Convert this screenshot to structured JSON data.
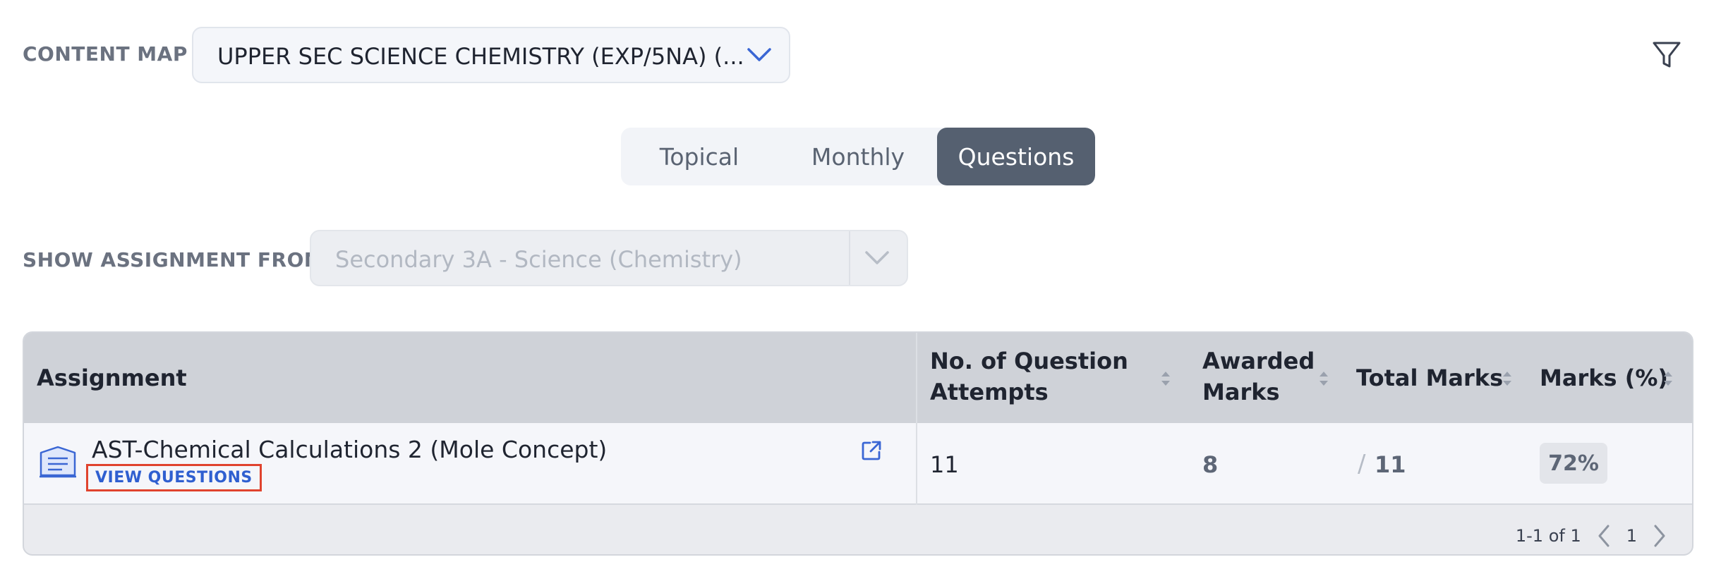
{
  "content_map": {
    "label": "CONTENT MAP",
    "selected": "UPPER SEC SCIENCE CHEMISTRY (EXP/5NA) (..."
  },
  "view_tabs": [
    {
      "label": "Topical",
      "active": false
    },
    {
      "label": "Monthly",
      "active": false
    },
    {
      "label": "Questions",
      "active": true
    }
  ],
  "show_assignment_from": {
    "label": "SHOW ASSIGNMENT FROM",
    "selected": "Secondary 3A - Science (Chemistry)"
  },
  "table": {
    "headers": {
      "assignment": "Assignment",
      "attempts_line1": "No. of Question",
      "attempts_line2": "Attempts",
      "awarded_line1": "Awarded",
      "awarded_line2": "Marks",
      "total": "Total Marks",
      "pct": "Marks (%)"
    },
    "rows": [
      {
        "assignment": "AST-Chemical Calculations 2 (Mole Concept)",
        "view_questions": "VIEW QUESTIONS",
        "attempts": "11",
        "awarded": "8",
        "slash": "/",
        "total": "11",
        "pct": "72%"
      }
    ]
  },
  "pagination": {
    "range": "1-1 of 1",
    "page": "1"
  },
  "colors": {
    "accent": "#2f5fd0",
    "active_tab": "#556070",
    "highlight_box": "#e0432e"
  },
  "icons": [
    "chevron-down-icon",
    "filter-icon",
    "assignment-icon",
    "external-link-icon",
    "sort-icon",
    "chevron-left-icon",
    "chevron-right-icon"
  ]
}
